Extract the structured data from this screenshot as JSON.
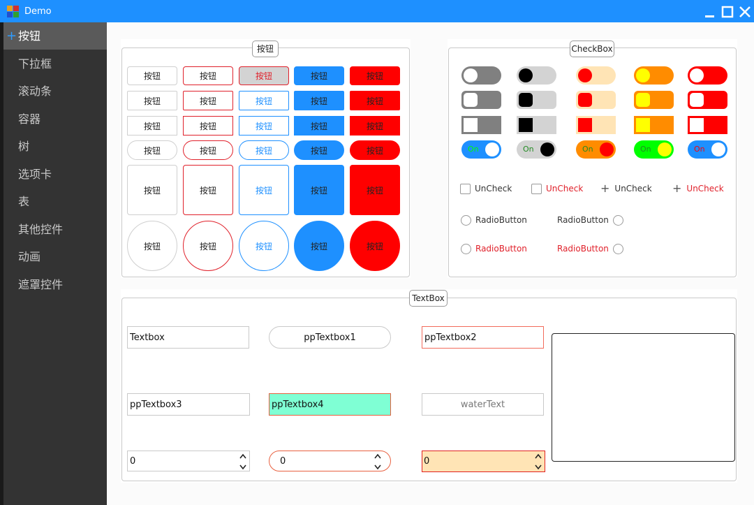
{
  "window": {
    "title": "Demo"
  },
  "sidebar": {
    "items": [
      {
        "label": "按钮",
        "active": true
      },
      {
        "label": "下拉框"
      },
      {
        "label": "滚动条"
      },
      {
        "label": "容器"
      },
      {
        "label": "树"
      },
      {
        "label": "选项卡"
      },
      {
        "label": "表"
      },
      {
        "label": "其他控件"
      },
      {
        "label": "动画"
      },
      {
        "label": "遮罩控件"
      }
    ]
  },
  "buttons_group": {
    "title": "按钮",
    "button_label": "按钮"
  },
  "checkbox_group": {
    "title": "CheckBox",
    "switch_on_label": "On",
    "checks": [
      {
        "label": "UnCheck",
        "style": "box",
        "color": "#333333"
      },
      {
        "label": "UnCheck",
        "style": "box",
        "color": "#e0202a"
      },
      {
        "label": "UnCheck",
        "style": "plus",
        "color": "#333333"
      },
      {
        "label": "UnCheck",
        "style": "plus",
        "color": "#e0202a"
      }
    ],
    "radios": [
      {
        "label": "RadioButton",
        "side": "left",
        "color": "#333333"
      },
      {
        "label": "RadioButton",
        "side": "right",
        "color": "#333333"
      },
      {
        "label": "RadioButton",
        "side": "left",
        "color": "#e0202a"
      },
      {
        "label": "RadioButton",
        "side": "right",
        "color": "#e0202a"
      }
    ]
  },
  "textbox_group": {
    "title": "TextBox",
    "tb1": "Textbox",
    "tb2": "ppTextbox1",
    "tb3": "ppTextbox2",
    "tb4": "ppTextbox3",
    "tb5": "ppTextbox4",
    "tb6_placeholder": "waterText",
    "num1": "0",
    "num2": "0",
    "num3": "0"
  },
  "colors": {
    "accent": "#1e90ff",
    "red": "#ff0000",
    "orange": "#ff8c00",
    "yellow": "#ffff00",
    "green": "#00ff00",
    "peach": "#ffe4b5",
    "teal_fill": "#7fffd4"
  }
}
